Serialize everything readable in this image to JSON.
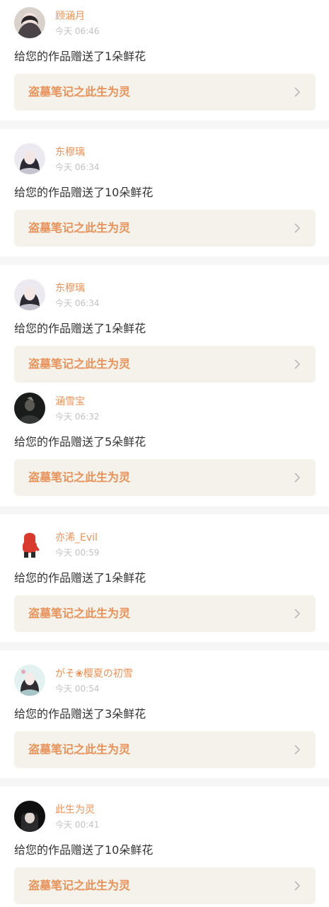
{
  "feed": [
    {
      "user": "顾涵月",
      "time": "今天 06:46",
      "message": "给您的作品赠送了1朵鲜花",
      "work": "盗墓笔记之此生为灵",
      "avatar": "avatar-woman-dark-hair"
    },
    {
      "user": "东穆璃",
      "time": "今天 06:34",
      "message": "给您的作品赠送了10朵鲜花",
      "work": "盗墓笔记之此生为灵",
      "avatar": "avatar-woman-long-hair"
    },
    {
      "user": "东穆璃",
      "time": "今天 06:34",
      "message": "给您的作品赠送了1朵鲜花",
      "work": "盗墓笔记之此生为灵",
      "avatar": "avatar-woman-long-hair"
    },
    {
      "user": "涵雪宝",
      "time": "今天 06:32",
      "message": "给您的作品赠送了5朵鲜花",
      "work": "盗墓笔记之此生为灵",
      "avatar": "avatar-dark-figure"
    },
    {
      "user": "亦浠_Evil",
      "time": "今天 00:59",
      "message": "给您的作品赠送了1朵鲜花",
      "work": "盗墓笔记之此生为灵",
      "avatar": "avatar-red-hoodie"
    },
    {
      "user": "がそ❀樱夏の初雪",
      "time": "今天 00:54",
      "message": "给您的作品赠送了3朵鲜花",
      "work": "盗墓笔记之此生为灵",
      "avatar": "avatar-woman-flower"
    },
    {
      "user": "此生为灵",
      "time": "今天 00:41",
      "message": "给您的作品赠送了10朵鲜花",
      "work": "盗墓笔记之此生为灵",
      "avatar": "avatar-dark-hoodie"
    }
  ],
  "colors": {
    "accent": "#e8925a",
    "card_bg": "#f4f2ea",
    "separator": "#f5f5f5",
    "text": "#333333",
    "muted": "#c2c2c2"
  },
  "icons": {
    "chevron": "chevron-right-icon"
  }
}
